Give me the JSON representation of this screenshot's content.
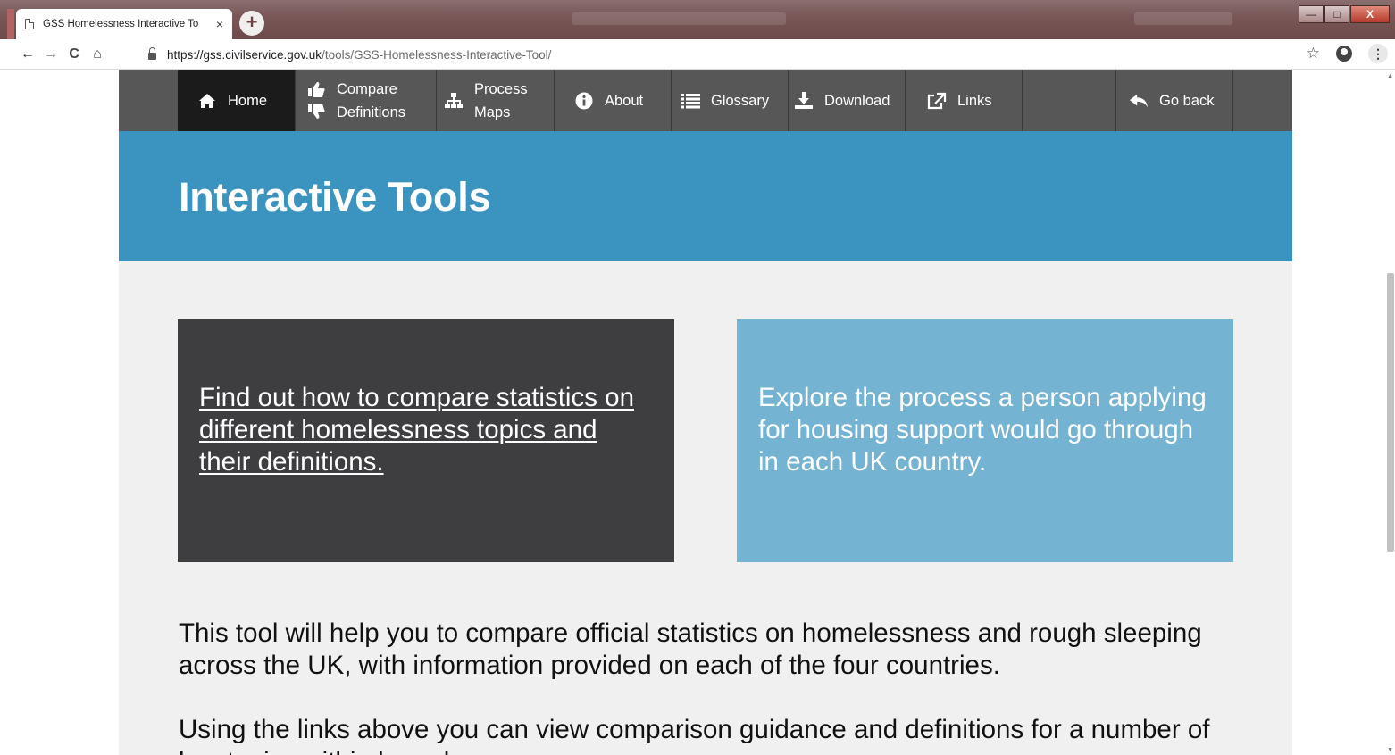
{
  "browser": {
    "tab_title": "GSS Homelessness Interactive To",
    "tab_close": "×",
    "new_tab": "+",
    "url_host": "https://gss.civilservice.gov.uk",
    "url_path": "/tools/GSS-Homelessness-Interactive-Tool/",
    "nav_back": "←",
    "nav_forward": "→",
    "nav_reload": "C",
    "nav_home": "⌂",
    "bookmark_star": "☆",
    "menu": "⋮",
    "window_minimize": "—",
    "window_maximize": "□",
    "window_close": "X"
  },
  "topnav": {
    "items": [
      {
        "label": "Home",
        "icon": "home-icon"
      },
      {
        "label_line1": "Compare",
        "label_line2": "Definitions",
        "icon": "thumbs-up-down-icon"
      },
      {
        "label_line1": "Process",
        "label_line2": "Maps",
        "icon": "sitemap-icon"
      },
      {
        "label": "About",
        "icon": "info-circle-icon"
      },
      {
        "label": "Glossary",
        "icon": "list-icon"
      },
      {
        "label": "Download",
        "icon": "download-icon"
      },
      {
        "label": "Links",
        "icon": "external-link-icon"
      },
      {
        "label": "Go back",
        "icon": "reply-arrow-icon"
      }
    ]
  },
  "hero": {
    "title": "Interactive Tools"
  },
  "cards": {
    "compare_link": "Find out how to compare statistics on different homelessness topics and their definitions.",
    "process_text": "Explore the process a person applying for housing support would go through in each UK country."
  },
  "body": {
    "paragraph1": "This tool will help you to compare official statistics on homelessness and rough sleeping across the UK, with information provided on each of the four countries.",
    "paragraph2": "Using the links above you can view comparison guidance and definitions for a number of key topics within homelessness."
  },
  "colors": {
    "nav_bg": "#575757",
    "nav_active": "#1b1b1b",
    "hero_bg": "#3b93c0",
    "card_dark": "#3e3e40",
    "card_light": "#75b3d3",
    "page_bg": "#f0f0f0"
  }
}
